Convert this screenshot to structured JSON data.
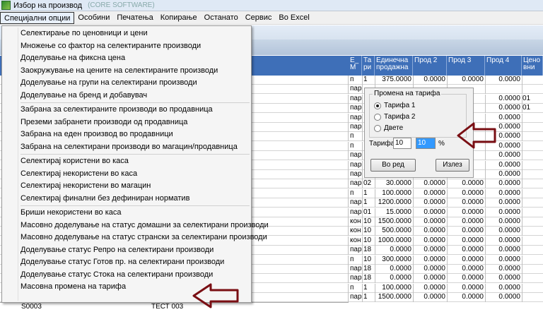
{
  "window": {
    "title": "Избор на производ",
    "title_extra": "(CORE SOFTWARE)"
  },
  "menu": [
    "Специјални опции",
    "Особини",
    "Печатења",
    "Копирање",
    "Останато",
    "Сервис",
    "Во Excel"
  ],
  "dropdown": {
    "groups": [
      [
        "Селектирање по ценовници и цени",
        "Множење со фактор на селектираните производи",
        "Доделување на фиксна цена",
        "Заокружување на цените на селектираните производи",
        "Доделување на групи на селектирани производи",
        "Доделување на бренд и добавувач"
      ],
      [
        "Забрана за селектираните производи во продавница",
        "Преземи забранети производи од продавница",
        "Забрана на еден производ во продавници",
        "Забрана на селектирани производи во магацин/продавница"
      ],
      [
        "Селектирај користени во каса",
        "Селектирај некористени во каса",
        "Селектирај некористени во магацин",
        "Селектирај финални без дефиниран норматив"
      ],
      [
        "Бриши некористени во каса",
        "Масовно доделување на статус домашни за селектирани производи",
        "Масовно доделување на статус странски за селектирани производи",
        "Доделување статус Репро на селектирани производи",
        "Доделување статус Готов пр. на селектирани производи",
        "Доделување статус Стока на селектирани производи",
        "Масовна промена на тарифа"
      ]
    ]
  },
  "grid": {
    "headers": [
      "Е_ М",
      "Та ри",
      "Единечна продажна",
      "Прод 2",
      "Прод 3",
      "Прод 4",
      "Цено вни"
    ],
    "rows": [
      [
        "п",
        "1",
        "375.0000",
        "0.0000",
        "0.0000",
        "0.0000",
        ""
      ],
      [
        "пар",
        "",
        "",
        "",
        "",
        "",
        ""
      ],
      [
        "пар",
        "",
        "",
        "",
        "",
        "0.0000",
        "01"
      ],
      [
        "пар",
        "",
        "",
        "",
        "",
        "0.0000",
        "01"
      ],
      [
        "пар",
        "",
        "",
        "",
        "",
        "0.0000",
        ""
      ],
      [
        "пар",
        "",
        "",
        "",
        "",
        "0.0000",
        ""
      ],
      [
        "п",
        "",
        "",
        "",
        "",
        "0.0000",
        ""
      ],
      [
        "п",
        "",
        "",
        "",
        "",
        "0.0000",
        ""
      ],
      [
        "пар",
        "",
        "",
        "",
        "",
        "0.0000",
        ""
      ],
      [
        "пар",
        "",
        "",
        "",
        "",
        "0.0000",
        ""
      ],
      [
        "пар",
        "",
        "",
        "",
        "",
        "0.0000",
        ""
      ],
      [
        "пар",
        "02",
        "30.0000",
        "0.0000",
        "0.0000",
        "0.0000",
        ""
      ],
      [
        "п",
        "1",
        "100.0000",
        "0.0000",
        "0.0000",
        "0.0000",
        ""
      ],
      [
        "пар",
        "1",
        "1200.0000",
        "0.0000",
        "0.0000",
        "0.0000",
        ""
      ],
      [
        "пар",
        "01",
        "15.0000",
        "0.0000",
        "0.0000",
        "0.0000",
        ""
      ],
      [
        "кон",
        "10",
        "1500.0000",
        "0.0000",
        "0.0000",
        "0.0000",
        ""
      ],
      [
        "кон",
        "10",
        "500.0000",
        "0.0000",
        "0.0000",
        "0.0000",
        ""
      ],
      [
        "кон",
        "10",
        "1000.0000",
        "0.0000",
        "0.0000",
        "0.0000",
        ""
      ],
      [
        "пар",
        "18",
        "0.0000",
        "0.0000",
        "0.0000",
        "0.0000",
        ""
      ],
      [
        "п",
        "10",
        "300.0000",
        "0.0000",
        "0.0000",
        "0.0000",
        ""
      ],
      [
        "пар",
        "18",
        "0.0000",
        "0.0000",
        "0.0000",
        "0.0000",
        ""
      ],
      [
        "пар",
        "18",
        "0.0000",
        "0.0000",
        "0.0000",
        "0.0000",
        ""
      ],
      [
        "п",
        "1",
        "100.0000",
        "0.0000",
        "0.0000",
        "0.0000",
        ""
      ],
      [
        "пар",
        "1",
        "1500.0000",
        "0.0000",
        "0.0000",
        "0.0000",
        ""
      ]
    ],
    "bottom_code": "S0003",
    "bottom_name": "ТЕСТ 003"
  },
  "tariff_panel": {
    "group_label": "Промена на тарифа",
    "options": [
      "Тарифа 1",
      "Тарифа 2",
      "Двете"
    ],
    "selected": 0,
    "field_label": "Тарифа",
    "tariff_value": "10",
    "percent_value": "10",
    "percent_sign": "%",
    "ok_label": "Во ред",
    "exit_label": "Излез"
  },
  "colors": {
    "header": "#3e6fb8",
    "arrow": "#7a0f14"
  }
}
